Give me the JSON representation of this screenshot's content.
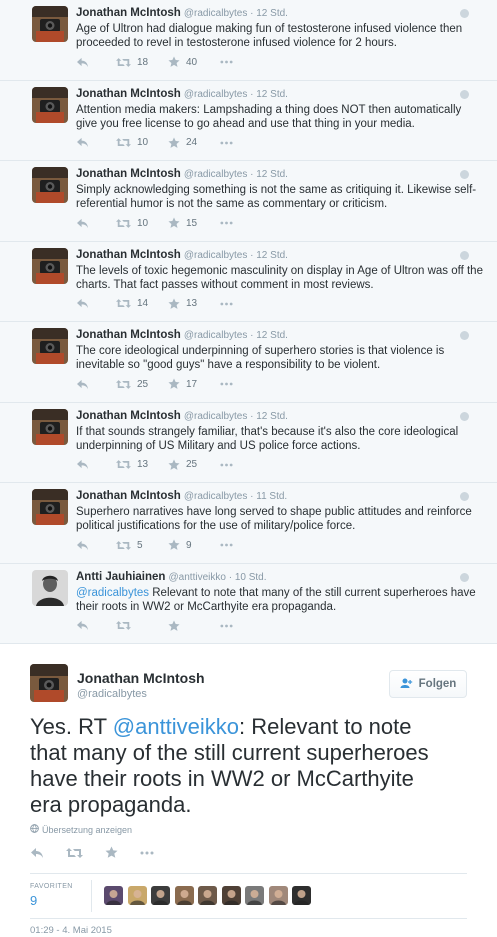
{
  "thread": [
    {
      "name": "Jonathan McIntosh",
      "handle": "@radicalbytes",
      "time": "12 Std.",
      "text": "Age of Ultron had dialogue making fun of testosterone infused violence then proceeded to revel in testosterone infused violence for 2 hours.",
      "retweets": "18",
      "favorites": "40"
    },
    {
      "name": "Jonathan McIntosh",
      "handle": "@radicalbytes",
      "time": "12 Std.",
      "text": "Attention media makers: Lampshading a thing does NOT then automatically give you free license to go ahead and use that thing in your media.",
      "retweets": "10",
      "favorites": "24"
    },
    {
      "name": "Jonathan McIntosh",
      "handle": "@radicalbytes",
      "time": "12 Std.",
      "text": "Simply acknowledging something is not the same as critiquing it. Likewise self-referential humor is not the same as commentary or criticism.",
      "retweets": "10",
      "favorites": "15"
    },
    {
      "name": "Jonathan McIntosh",
      "handle": "@radicalbytes",
      "time": "12 Std.",
      "text": "The levels of toxic hegemonic masculinity on display in Age of Ultron was off the charts. That fact passes without comment in most reviews.",
      "retweets": "14",
      "favorites": "13"
    },
    {
      "name": "Jonathan McIntosh",
      "handle": "@radicalbytes",
      "time": "12 Std.",
      "text": "The core ideological underpinning of superhero stories is that violence is inevitable so \"good guys\" have a responsibility to be violent.",
      "retweets": "25",
      "favorites": "17"
    },
    {
      "name": "Jonathan McIntosh",
      "handle": "@radicalbytes",
      "time": "12 Std.",
      "text": "If that sounds strangely familiar, that's because it's also the core ideological underpinning of US Military and US police force actions.",
      "retweets": "13",
      "favorites": "25"
    },
    {
      "name": "Jonathan McIntosh",
      "handle": "@radicalbytes",
      "time": "11 Std.",
      "text": "Superhero narratives have long served to shape public attitudes and reinforce political justifications for the use of military/police force.",
      "retweets": "5",
      "favorites": "9"
    },
    {
      "name": "Antti Jauhiainen",
      "handle": "@anttiveikko",
      "time": "10 Std.",
      "mention": "@radicalbytes",
      "text": " Relevant to note that many of the still current superheroes have their roots in WW2 or McCarthyite era propaganda.",
      "retweets": "",
      "favorites": ""
    }
  ],
  "main_tweet": {
    "name": "Jonathan McIntosh",
    "handle": "@radicalbytes",
    "follow_label": "Folgen",
    "text_prefix": "Yes. RT ",
    "mention": "@anttiveikko",
    "text_suffix": ": Relevant to note that many of the still current superheroes have their roots in WW2 or McCarthyite era propaganda.",
    "translate_label": "Übersetzung anzeigen",
    "favorites_label": "FAVORITEN",
    "favorites_count": "9",
    "datetime": "01:29 - 4. Mai 2015"
  },
  "colors": {
    "accent": "#3b94d9",
    "muted": "#8899a6",
    "text": "#292f33",
    "border": "#e1e8ed"
  },
  "icons": [
    "reply-icon",
    "retweet-icon",
    "favorite-icon",
    "more-icon",
    "follow-icon",
    "globe-icon"
  ]
}
